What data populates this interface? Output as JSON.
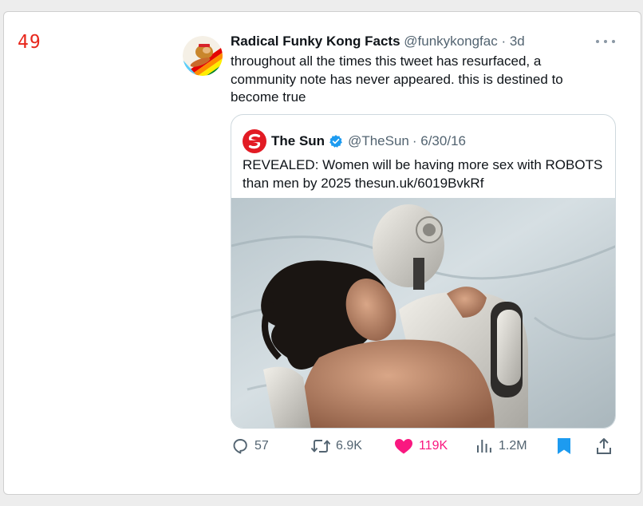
{
  "rank": "49",
  "tweet": {
    "author_name": "Radical Funky Kong Facts",
    "handle": "@funkykongfac",
    "time": "· 3d",
    "text": "throughout all the times this tweet has resurfaced, a community note has never appeared. this is destined to become true"
  },
  "quote": {
    "author_name": "The Sun",
    "handle": "@TheSun",
    "time": "· 6/30/16",
    "text": "REVEALED: Women will be having more sex with ROBOTS than men by 2025 thesun.uk/6019BvkRf"
  },
  "actions": {
    "replies": "57",
    "reposts": "6.9K",
    "likes": "119K",
    "views": "1.2M"
  },
  "colors": {
    "rank": "#e8271c",
    "like": "#f91880",
    "bookmark": "#1d9bf0",
    "verified": "#1d9bf0"
  },
  "icons": [
    "more-icon",
    "verified-icon",
    "sun-logo-icon",
    "reply-icon",
    "repost-icon",
    "heart-icon",
    "views-icon",
    "bookmark-icon",
    "share-icon"
  ]
}
